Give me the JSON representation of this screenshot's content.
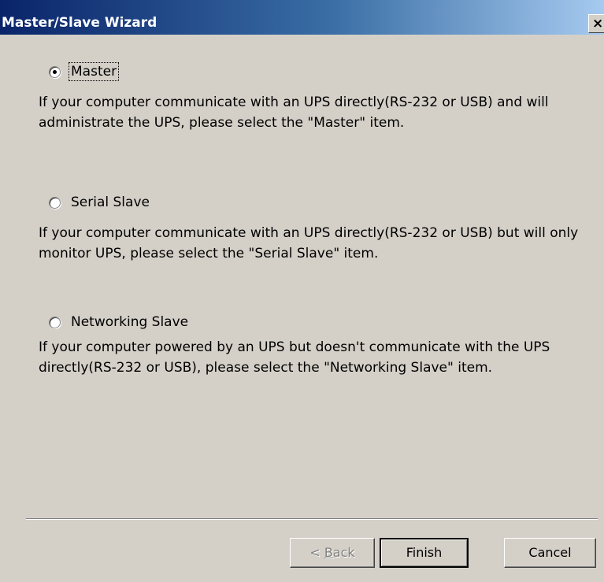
{
  "window": {
    "title": "Master/Slave Wizard",
    "close_glyph": "×"
  },
  "options": [
    {
      "label": "Master",
      "selected": true,
      "description": "If your computer communicate with an UPS directly(RS-232 or USB) and will administrate the UPS, please select the \"Master\" item."
    },
    {
      "label": "Serial Slave",
      "selected": false,
      "description": "If your computer communicate with an UPS directly(RS-232 or USB) but will only monitor UPS, please select the \"Serial Slave\" item."
    },
    {
      "label": "Networking Slave",
      "selected": false,
      "description": "If your computer powered by an UPS but doesn't communicate with the UPS directly(RS-232 or USB), please select the \"Networking Slave\" item."
    }
  ],
  "buttons": {
    "back_prefix": "< ",
    "back_mnemonic": "B",
    "back_rest": "ack",
    "finish": "Finish",
    "cancel": "Cancel"
  },
  "colors": {
    "title_start": "#0a246a",
    "title_end": "#a6caf0",
    "face": "#d4d0c8"
  }
}
